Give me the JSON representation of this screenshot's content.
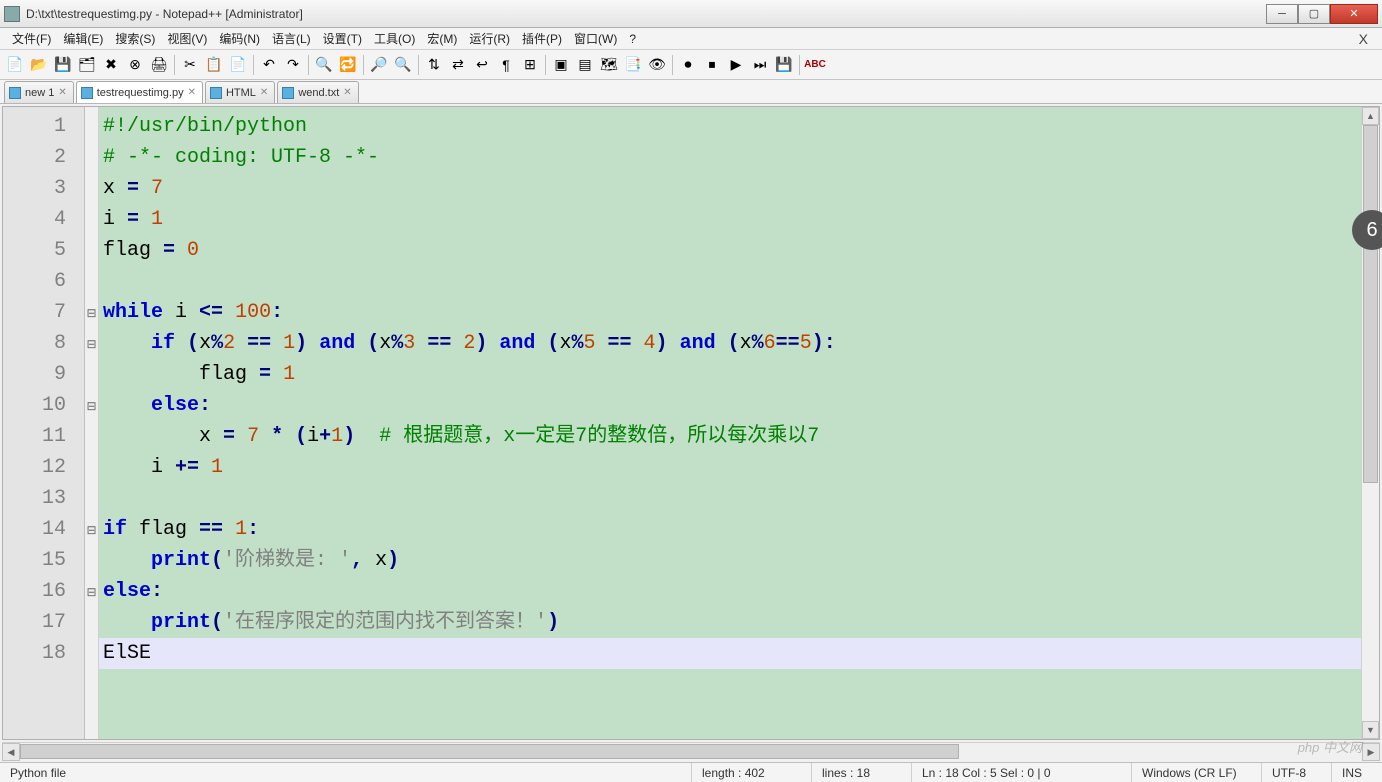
{
  "window": {
    "title": "D:\\txt\\testrequestimg.py - Notepad++ [Administrator]"
  },
  "menu": {
    "items": [
      "文件(F)",
      "编辑(E)",
      "搜索(S)",
      "视图(V)",
      "编码(N)",
      "语言(L)",
      "设置(T)",
      "工具(O)",
      "宏(M)",
      "运行(R)",
      "插件(P)",
      "窗口(W)",
      "?"
    ]
  },
  "tabs": {
    "items": [
      {
        "label": "new 1",
        "active": false
      },
      {
        "label": "testrequestimg.py",
        "active": true
      },
      {
        "label": "HTML",
        "active": false
      },
      {
        "label": "wend.txt",
        "active": false
      }
    ]
  },
  "code": {
    "lines": [
      {
        "n": 1,
        "seg": [
          {
            "c": "comm",
            "t": "#!/usr/bin/python"
          }
        ],
        "fold": ""
      },
      {
        "n": 2,
        "seg": [
          {
            "c": "comm",
            "t": "# -*- coding: UTF-8 -*-"
          }
        ],
        "fold": ""
      },
      {
        "n": 3,
        "seg": [
          {
            "c": "txt",
            "t": "x "
          },
          {
            "c": "op",
            "t": "="
          },
          {
            "c": "txt",
            "t": " "
          },
          {
            "c": "num",
            "t": "7"
          }
        ],
        "fold": ""
      },
      {
        "n": 4,
        "seg": [
          {
            "c": "txt",
            "t": "i "
          },
          {
            "c": "op",
            "t": "="
          },
          {
            "c": "txt",
            "t": " "
          },
          {
            "c": "num",
            "t": "1"
          }
        ],
        "fold": ""
      },
      {
        "n": 5,
        "seg": [
          {
            "c": "txt",
            "t": "flag "
          },
          {
            "c": "op",
            "t": "="
          },
          {
            "c": "txt",
            "t": " "
          },
          {
            "c": "num",
            "t": "0"
          }
        ],
        "fold": ""
      },
      {
        "n": 6,
        "seg": [
          {
            "c": "txt",
            "t": ""
          }
        ],
        "fold": ""
      },
      {
        "n": 7,
        "seg": [
          {
            "c": "kw",
            "t": "while"
          },
          {
            "c": "txt",
            "t": " i "
          },
          {
            "c": "op",
            "t": "<="
          },
          {
            "c": "txt",
            "t": " "
          },
          {
            "c": "num",
            "t": "100"
          },
          {
            "c": "op",
            "t": ":"
          }
        ],
        "fold": "box"
      },
      {
        "n": 8,
        "seg": [
          {
            "c": "txt",
            "t": "    "
          },
          {
            "c": "kw",
            "t": "if"
          },
          {
            "c": "txt",
            "t": " "
          },
          {
            "c": "op",
            "t": "("
          },
          {
            "c": "txt",
            "t": "x"
          },
          {
            "c": "op",
            "t": "%"
          },
          {
            "c": "num",
            "t": "2"
          },
          {
            "c": "txt",
            "t": " "
          },
          {
            "c": "op",
            "t": "=="
          },
          {
            "c": "txt",
            "t": " "
          },
          {
            "c": "num",
            "t": "1"
          },
          {
            "c": "op",
            "t": ")"
          },
          {
            "c": "txt",
            "t": " "
          },
          {
            "c": "kw",
            "t": "and"
          },
          {
            "c": "txt",
            "t": " "
          },
          {
            "c": "op",
            "t": "("
          },
          {
            "c": "txt",
            "t": "x"
          },
          {
            "c": "op",
            "t": "%"
          },
          {
            "c": "num",
            "t": "3"
          },
          {
            "c": "txt",
            "t": " "
          },
          {
            "c": "op",
            "t": "=="
          },
          {
            "c": "txt",
            "t": " "
          },
          {
            "c": "num",
            "t": "2"
          },
          {
            "c": "op",
            "t": ")"
          },
          {
            "c": "txt",
            "t": " "
          },
          {
            "c": "kw",
            "t": "and"
          },
          {
            "c": "txt",
            "t": " "
          },
          {
            "c": "op",
            "t": "("
          },
          {
            "c": "txt",
            "t": "x"
          },
          {
            "c": "op",
            "t": "%"
          },
          {
            "c": "num",
            "t": "5"
          },
          {
            "c": "txt",
            "t": " "
          },
          {
            "c": "op",
            "t": "=="
          },
          {
            "c": "txt",
            "t": " "
          },
          {
            "c": "num",
            "t": "4"
          },
          {
            "c": "op",
            "t": ")"
          },
          {
            "c": "txt",
            "t": " "
          },
          {
            "c": "kw",
            "t": "and"
          },
          {
            "c": "txt",
            "t": " "
          },
          {
            "c": "op",
            "t": "("
          },
          {
            "c": "txt",
            "t": "x"
          },
          {
            "c": "op",
            "t": "%"
          },
          {
            "c": "num",
            "t": "6"
          },
          {
            "c": "op",
            "t": "=="
          },
          {
            "c": "num",
            "t": "5"
          },
          {
            "c": "op",
            "t": "):"
          }
        ],
        "fold": "box"
      },
      {
        "n": 9,
        "seg": [
          {
            "c": "txt",
            "t": "        flag "
          },
          {
            "c": "op",
            "t": "="
          },
          {
            "c": "txt",
            "t": " "
          },
          {
            "c": "num",
            "t": "1"
          }
        ],
        "fold": ""
      },
      {
        "n": 10,
        "seg": [
          {
            "c": "txt",
            "t": "    "
          },
          {
            "c": "kw",
            "t": "else"
          },
          {
            "c": "op",
            "t": ":"
          }
        ],
        "fold": "box"
      },
      {
        "n": 11,
        "seg": [
          {
            "c": "txt",
            "t": "        x "
          },
          {
            "c": "op",
            "t": "="
          },
          {
            "c": "txt",
            "t": " "
          },
          {
            "c": "num",
            "t": "7"
          },
          {
            "c": "txt",
            "t": " "
          },
          {
            "c": "op",
            "t": "*"
          },
          {
            "c": "txt",
            "t": " "
          },
          {
            "c": "op",
            "t": "("
          },
          {
            "c": "txt",
            "t": "i"
          },
          {
            "c": "op",
            "t": "+"
          },
          {
            "c": "num",
            "t": "1"
          },
          {
            "c": "op",
            "t": ")"
          },
          {
            "c": "txt",
            "t": "  "
          },
          {
            "c": "comm",
            "t": "# 根据题意，x一定是7的整数倍，所以每次乘以7"
          }
        ],
        "fold": ""
      },
      {
        "n": 12,
        "seg": [
          {
            "c": "txt",
            "t": "    i "
          },
          {
            "c": "op",
            "t": "+="
          },
          {
            "c": "txt",
            "t": " "
          },
          {
            "c": "num",
            "t": "1"
          }
        ],
        "fold": ""
      },
      {
        "n": 13,
        "seg": [
          {
            "c": "txt",
            "t": ""
          }
        ],
        "fold": ""
      },
      {
        "n": 14,
        "seg": [
          {
            "c": "kw",
            "t": "if"
          },
          {
            "c": "txt",
            "t": " flag "
          },
          {
            "c": "op",
            "t": "=="
          },
          {
            "c": "txt",
            "t": " "
          },
          {
            "c": "num",
            "t": "1"
          },
          {
            "c": "op",
            "t": ":"
          }
        ],
        "fold": "box"
      },
      {
        "n": 15,
        "seg": [
          {
            "c": "txt",
            "t": "    "
          },
          {
            "c": "kw",
            "t": "print"
          },
          {
            "c": "op",
            "t": "("
          },
          {
            "c": "str",
            "t": "'阶梯数是: '"
          },
          {
            "c": "op",
            "t": ","
          },
          {
            "c": "txt",
            "t": " x"
          },
          {
            "c": "op",
            "t": ")"
          }
        ],
        "fold": ""
      },
      {
        "n": 16,
        "seg": [
          {
            "c": "kw",
            "t": "else"
          },
          {
            "c": "op",
            "t": ":"
          }
        ],
        "fold": "box"
      },
      {
        "n": 17,
        "seg": [
          {
            "c": "txt",
            "t": "    "
          },
          {
            "c": "kw",
            "t": "print"
          },
          {
            "c": "op",
            "t": "("
          },
          {
            "c": "str",
            "t": "'在程序限定的范围内找不到答案！'"
          },
          {
            "c": "op",
            "t": ")"
          }
        ],
        "fold": ""
      },
      {
        "n": 18,
        "seg": [
          {
            "c": "txt",
            "t": "ElSE"
          }
        ],
        "fold": "",
        "current": true
      }
    ]
  },
  "status": {
    "filetype": "Python file",
    "length": "length : 402",
    "lines": "lines : 18",
    "pos": "Ln : 18    Col : 5    Sel : 0 | 0",
    "eol": "Windows (CR LF)",
    "encoding": "UTF-8",
    "mode": "INS"
  },
  "watermark": "php 中文网",
  "side_badge": "6"
}
